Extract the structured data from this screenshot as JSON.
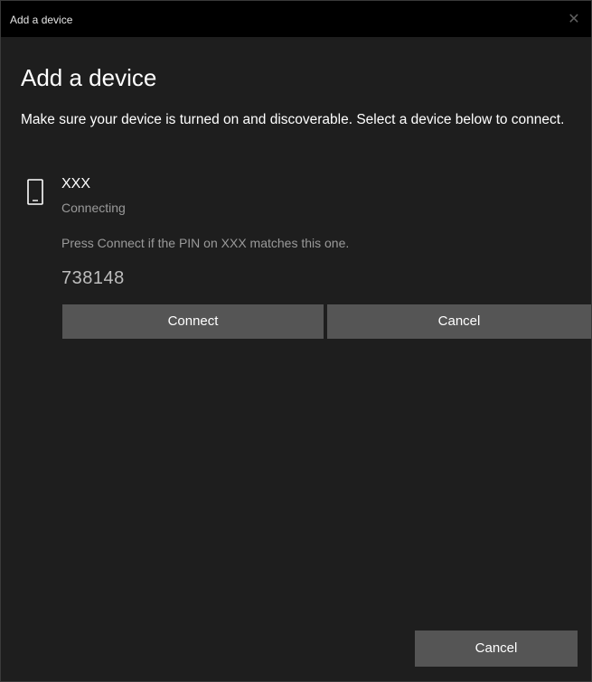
{
  "window": {
    "title": "Add a device",
    "close_glyph": "✕"
  },
  "main": {
    "heading": "Add a device",
    "instructions": "Make sure your device is turned on and discoverable. Select a device below to connect."
  },
  "device": {
    "icon": "phone-icon",
    "name": "XXX",
    "status": "Connecting",
    "pin_prompt": "Press Connect if the PIN on XXX matches this one.",
    "pin": "738148"
  },
  "buttons": {
    "connect_label": "Connect",
    "cancel_inline_label": "Cancel",
    "cancel_footer_label": "Cancel"
  },
  "colors": {
    "background": "#1e1e1e",
    "titlebar": "#000000",
    "button": "#555555",
    "secondary_text": "#9a9a9a"
  }
}
